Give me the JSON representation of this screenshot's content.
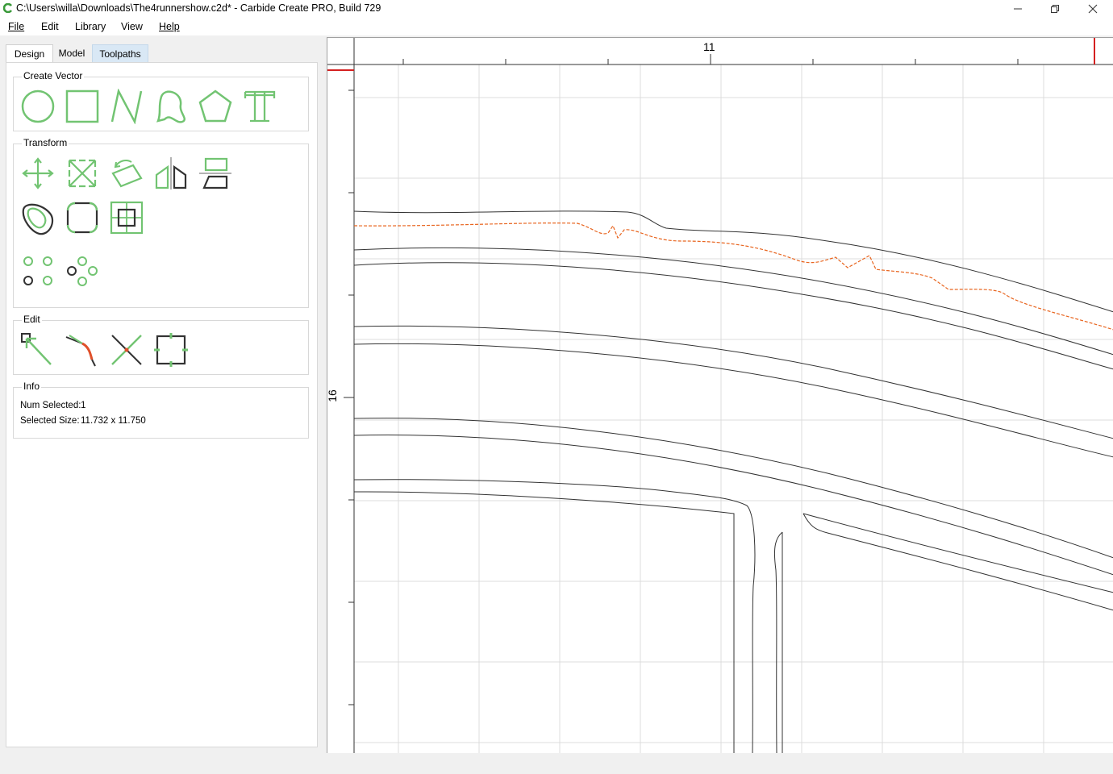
{
  "window": {
    "title": "C:\\Users\\willa\\Downloads\\The4runnershow.c2d* - Carbide Create PRO, Build 729"
  },
  "menu": {
    "items": [
      {
        "label": "File"
      },
      {
        "label": "Edit"
      },
      {
        "label": "Library"
      },
      {
        "label": "View"
      },
      {
        "label": "Help"
      }
    ]
  },
  "tabs": {
    "design": "Design",
    "model": "Model",
    "toolpaths": "Toolpaths"
  },
  "groups": {
    "create_vector": "Create Vector",
    "transform": "Transform",
    "edit": "Edit",
    "info": "Info"
  },
  "info": {
    "num_selected_label": "Num Selected:",
    "num_selected_value": "1",
    "selected_size_label": "Selected Size:",
    "selected_size_value": "11.732 x 11.750"
  },
  "rulers": {
    "x_label": "11",
    "y_label": "16"
  },
  "colors": {
    "tool_green": "#72c472",
    "selected_path": "#e8641e",
    "ruler_marker": "#d42020",
    "tab_highlight": "#d9e8f5"
  },
  "icons": {
    "create_vector": [
      "circle-icon",
      "rectangle-icon",
      "polyline-icon",
      "curve-icon",
      "polygon-icon",
      "text-icon"
    ],
    "transform": [
      "move-icon",
      "scale-icon",
      "rotate-icon",
      "mirror-icon",
      "flip-icon",
      "offset-icon",
      "fillet-icon",
      "align-icon",
      "grid-array-icon",
      "circular-array-icon"
    ],
    "edit": [
      "node-edit-icon",
      "trim-icon",
      "cut-icon",
      "boundary-icon"
    ]
  }
}
